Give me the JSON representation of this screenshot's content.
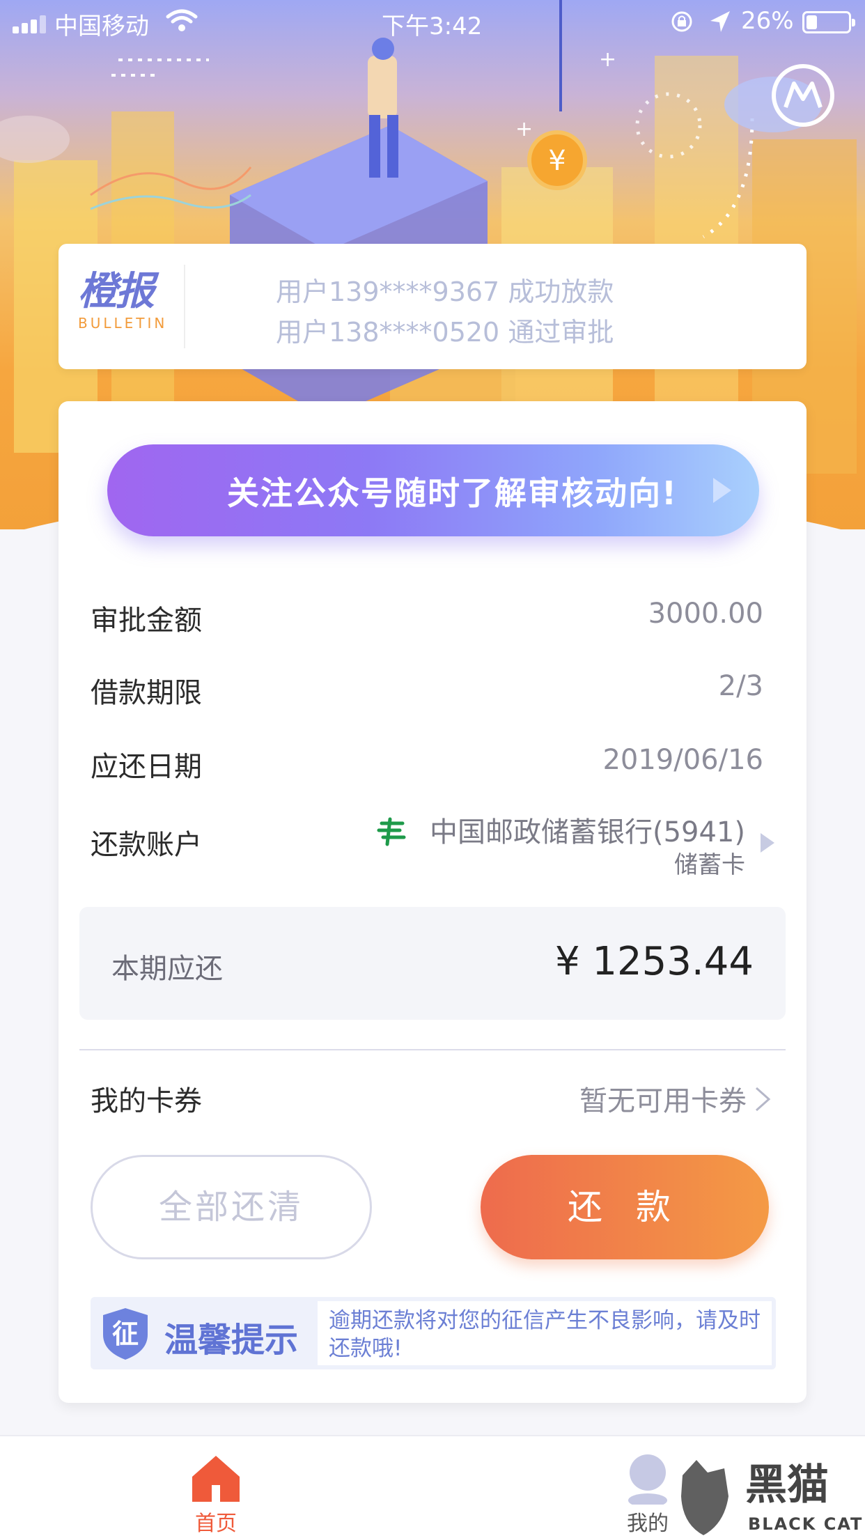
{
  "status_bar": {
    "carrier": "中国移动",
    "time": "下午3:42",
    "battery": "26%",
    "battery_level": 0.26
  },
  "bulletin": {
    "logo_text": "橙报",
    "logo_sub": "BULLETIN",
    "lines": [
      "用户139****9367 成功放款",
      "用户138****0520 通过审批"
    ]
  },
  "promo": {
    "text": "关注公众号随时了解审核动向!"
  },
  "loan": {
    "rows": [
      {
        "label": "审批金额",
        "value": "3000.00"
      },
      {
        "label": "借款期限",
        "value": "2/3"
      },
      {
        "label": "应还日期",
        "value": "2019/06/16"
      }
    ],
    "account_label": "还款账户",
    "bank_name": "中国邮政储蓄银行(5941)",
    "bank_type": "储蓄卡"
  },
  "due": {
    "label": "本期应还",
    "amount": "¥ 1253.44"
  },
  "coupon": {
    "label": "我的卡券",
    "value": "暂无可用卡券"
  },
  "buttons": {
    "pay_all": "全部还清",
    "repay": "还 款"
  },
  "tip": {
    "title": "温馨提示",
    "badge_char": "征",
    "text": "逾期还款将对您的征信产生不良影响，请及时还款哦!"
  },
  "tabbar": {
    "home": "首页",
    "mine": "我的"
  },
  "watermark": {
    "text": "黑猫",
    "sub": "BLACK CAT"
  },
  "colors": {
    "accent_orange": "#f0704c",
    "accent_blue": "#5f73d4",
    "home_active": "#ef5a3a"
  }
}
